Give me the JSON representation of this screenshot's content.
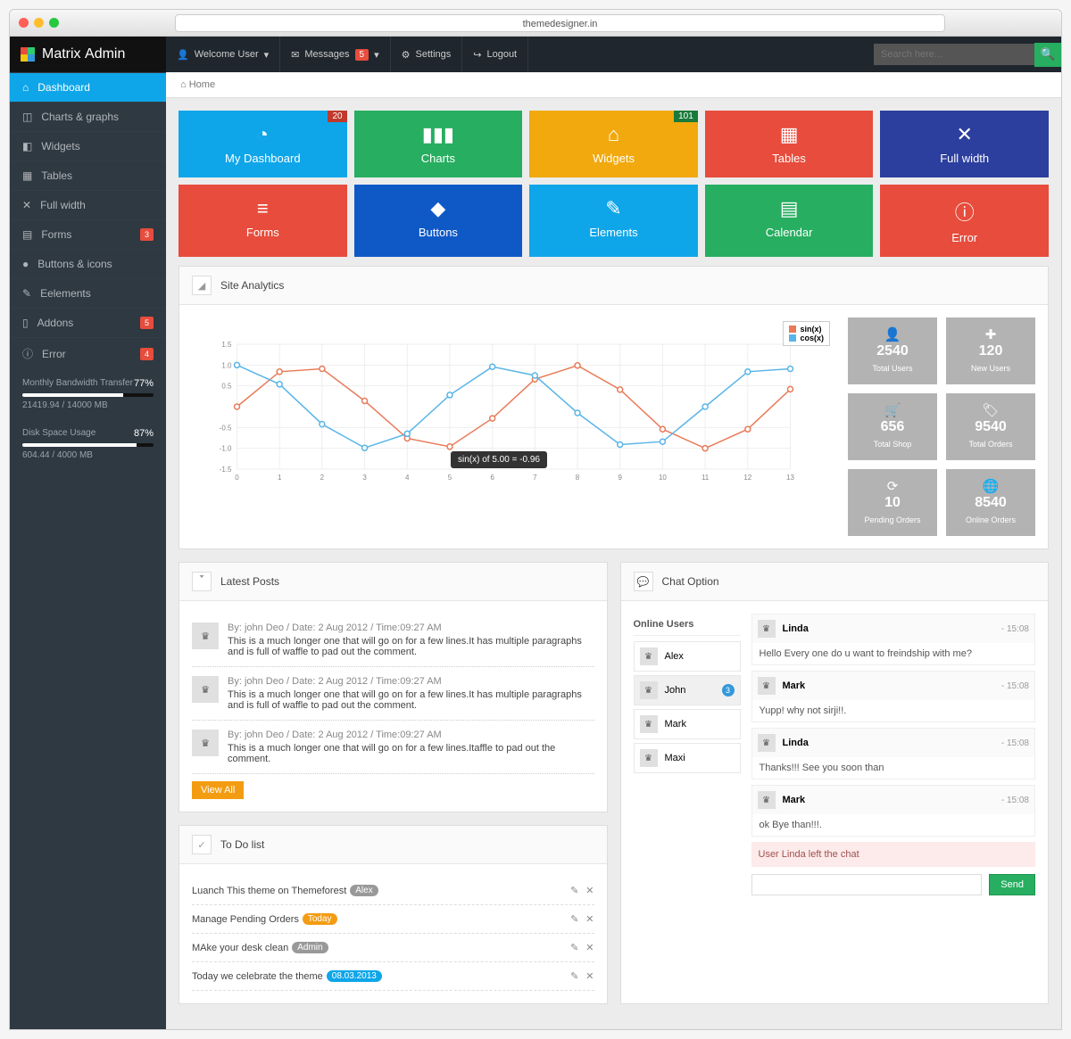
{
  "browser": {
    "url": "themedesigner.in"
  },
  "brand": {
    "first": "Matrix",
    "second": "Admin"
  },
  "topnav": {
    "welcome": "Welcome User",
    "messages": "Messages",
    "messages_badge": "5",
    "settings": "Settings",
    "logout": "Logout",
    "search_placeholder": "Search here..."
  },
  "breadcrumb": {
    "home": "Home"
  },
  "sidebar": {
    "items": [
      {
        "label": "Dashboard",
        "icon": "⌂",
        "active": true
      },
      {
        "label": "Charts & graphs",
        "icon": "◫"
      },
      {
        "label": "Widgets",
        "icon": "◧"
      },
      {
        "label": "Tables",
        "icon": "▦"
      },
      {
        "label": "Full width",
        "icon": "✕"
      },
      {
        "label": "Forms",
        "icon": "▤",
        "badge": "3"
      },
      {
        "label": "Buttons & icons",
        "icon": "●"
      },
      {
        "label": "Eelements",
        "icon": "✎"
      },
      {
        "label": "Addons",
        "icon": "▯",
        "badge": "5"
      },
      {
        "label": "Error",
        "icon": "ⓘ",
        "badge": "4"
      }
    ],
    "bandwidth": {
      "title": "Monthly Bandwidth Transfer",
      "text": "21419.94 / 14000 MB",
      "pct": "77%",
      "pctv": 77
    },
    "disk": {
      "title": "Disk Space Usage",
      "text": "604.44 / 4000 MB",
      "pct": "87%",
      "pctv": 87
    }
  },
  "tiles": [
    {
      "label": "My Dashboard",
      "icon": "◔",
      "color": "#0fa6e9",
      "corner": "20",
      "corner_color": ""
    },
    {
      "label": "Charts",
      "icon": "▮▮▮",
      "color": "#27ae60"
    },
    {
      "label": "Widgets",
      "icon": "⌂",
      "color": "#f1a90e",
      "corner": "101",
      "corner_color": "green"
    },
    {
      "label": "Tables",
      "icon": "▦",
      "color": "#e74c3c"
    },
    {
      "label": "Full width",
      "icon": "✕",
      "color": "#2c3e9e"
    },
    {
      "label": "Forms",
      "icon": "≡",
      "color": "#e74c3c"
    },
    {
      "label": "Buttons",
      "icon": "◆",
      "color": "#0f59c7"
    },
    {
      "label": "Elements",
      "icon": "✎",
      "color": "#0fa6e9"
    },
    {
      "label": "Calendar",
      "icon": "▤",
      "color": "#27ae60"
    },
    {
      "label": "Error",
      "icon": "ⓘ",
      "color": "#e74c3c"
    }
  ],
  "analytics": {
    "title": "Site Analytics",
    "tooltip": "sin(x) of 5.00 = -0.96",
    "legend": {
      "a": "sin(x)",
      "b": "cos(x)"
    }
  },
  "chart_data": {
    "type": "line",
    "x": [
      0,
      1,
      2,
      3,
      4,
      5,
      6,
      7,
      8,
      9,
      10,
      11,
      12,
      13
    ],
    "series": [
      {
        "name": "sin(x)",
        "color": "#e97b59",
        "values": [
          0.0,
          0.84,
          0.91,
          0.14,
          -0.76,
          -0.96,
          -0.28,
          0.66,
          0.99,
          0.41,
          -0.54,
          -1.0,
          -0.54,
          0.42
        ]
      },
      {
        "name": "cos(x)",
        "color": "#5ab5e8",
        "values": [
          1.0,
          0.54,
          -0.42,
          -0.99,
          -0.65,
          0.28,
          0.96,
          0.75,
          -0.15,
          -0.91,
          -0.84,
          0.0,
          0.84,
          0.91
        ]
      }
    ],
    "ylim": [
      -1.5,
      1.5
    ],
    "yticks": [
      -1.5,
      -1.0,
      -0.5,
      0.5,
      1.0,
      1.5
    ],
    "xlabel": "",
    "ylabel": ""
  },
  "stats": [
    {
      "icon": "👤",
      "value": "2540",
      "label": "Total Users"
    },
    {
      "icon": "✚",
      "value": "120",
      "label": "New Users"
    },
    {
      "icon": "🛒",
      "value": "656",
      "label": "Total Shop"
    },
    {
      "icon": "🏷",
      "value": "9540",
      "label": "Total Orders"
    },
    {
      "icon": "⟳",
      "value": "10",
      "label": "Pending Orders"
    },
    {
      "icon": "🌐",
      "value": "8540",
      "label": "Online Orders"
    }
  ],
  "posts": {
    "title": "Latest Posts",
    "viewall": "View All",
    "items": [
      {
        "meta": "By: john Deo / Date: 2 Aug 2012 / Time:09:27 AM",
        "body": "This is a much longer one that will go on for a few lines.It has multiple paragraphs and is full of waffle to pad out the comment."
      },
      {
        "meta": "By: john Deo / Date: 2 Aug 2012 / Time:09:27 AM",
        "body": "This is a much longer one that will go on for a few lines.It has multiple paragraphs and is full of waffle to pad out the comment."
      },
      {
        "meta": "By: john Deo / Date: 2 Aug 2012 / Time:09:27 AM",
        "body": "This is a much longer one that will go on for a few lines.Itaffle to pad out the comment."
      }
    ]
  },
  "todo": {
    "title": "To Do list",
    "items": [
      {
        "text": "Luanch This theme on Themeforest",
        "tag": "Alex",
        "tagc": "grey"
      },
      {
        "text": "Manage Pending Orders",
        "tag": "Today",
        "tagc": "orange"
      },
      {
        "text": "MAke your desk clean",
        "tag": "Admin",
        "tagc": "grey"
      },
      {
        "text": "Today we celebrate the theme",
        "tag": "08.03.2013",
        "tagc": "blue"
      }
    ]
  },
  "chat": {
    "title": "Chat Option",
    "online_title": "Online Users",
    "users": [
      {
        "name": "Alex"
      },
      {
        "name": "John",
        "badge": "3",
        "sel": true
      },
      {
        "name": "Mark"
      },
      {
        "name": "Maxi"
      }
    ],
    "messages": [
      {
        "name": "Linda",
        "time": "- 15:08",
        "body": "Hello Every one do u want to freindship with me?"
      },
      {
        "name": "Mark",
        "time": "- 15:08",
        "body": "Yupp! why not sirji!!."
      },
      {
        "name": "Linda",
        "time": "- 15:08",
        "body": "Thanks!!! See you soon than"
      },
      {
        "name": "Mark",
        "time": "- 15:08",
        "body": "ok Bye than!!!."
      }
    ],
    "notice": "User Linda left the chat",
    "send": "Send"
  }
}
